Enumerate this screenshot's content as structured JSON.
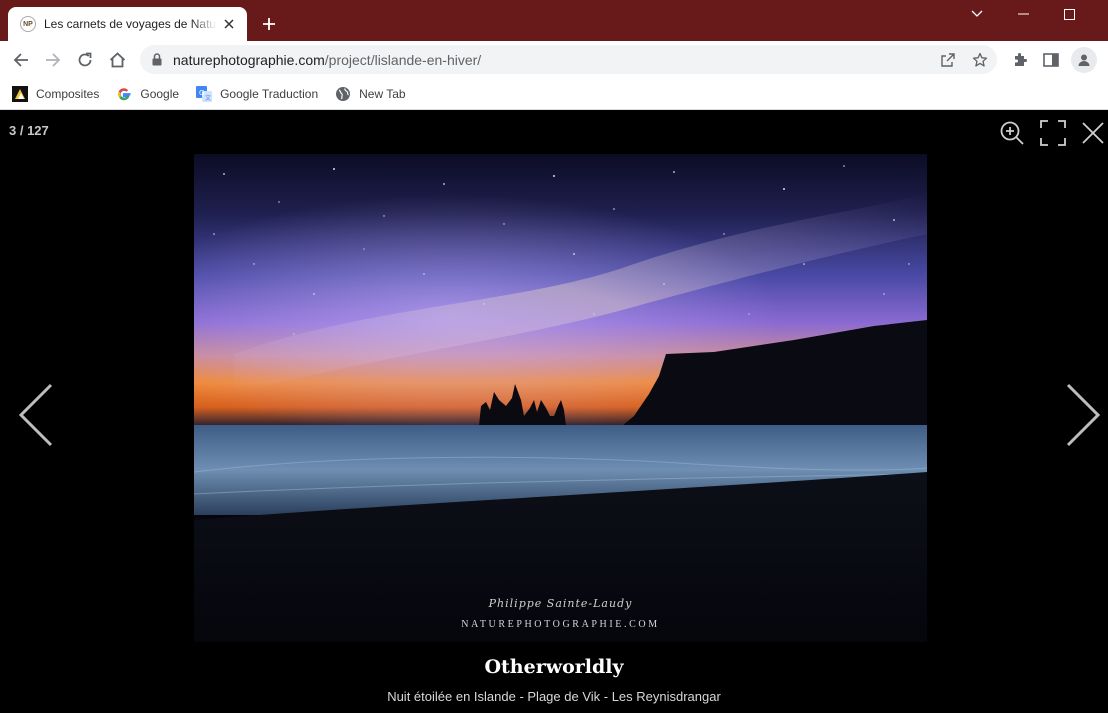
{
  "browser": {
    "tab": {
      "title": "Les carnets de voyages de Nature",
      "favicon_text": "NP"
    },
    "url": {
      "host": "naturephotographie.com",
      "path": "/project/lislande-en-hiver/"
    },
    "bookmarks": [
      {
        "label": "Composites",
        "icon": "composites-icon"
      },
      {
        "label": "Google",
        "icon": "google-icon"
      },
      {
        "label": "Google Traduction",
        "icon": "google-translate-icon"
      },
      {
        "label": "New Tab",
        "icon": "globe-icon"
      }
    ]
  },
  "lightbox": {
    "counter": "3 / 127",
    "photo": {
      "watermark_signature": "Philippe Sainte-Laudy",
      "watermark_site": "NATUREPHOTOGRAPHIE.COM"
    },
    "caption": {
      "title": "Otherworldly",
      "subtitle": "Nuit étoilée en Islande - Plage de Vik - Les Reynisdrangar"
    }
  },
  "colors": {
    "tabstrip": "#681a1a",
    "lightbox_bg": "#000000",
    "horizon_glow": "#f08a38",
    "sky_violet": "#6a55c8"
  }
}
